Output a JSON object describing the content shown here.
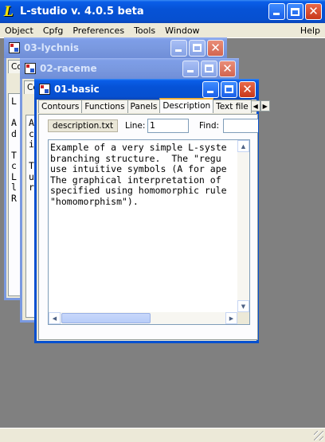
{
  "app": {
    "title": "L-studio v. 4.0.5 beta",
    "menu": [
      "Object",
      "Cpfg",
      "Preferences",
      "Tools",
      "Window"
    ],
    "help": "Help"
  },
  "windows": {
    "back": {
      "title": "03-lychnis",
      "tab_fragment": "Co",
      "letters": "L\n\nA\nd\n\nT\nc\nL\nl\nR"
    },
    "middle": {
      "title": "02-raceme",
      "tab_fragment": "Co",
      "letters": "A\nc\ni\n\nT\nu\nr"
    },
    "front": {
      "title": "01-basic",
      "tabs": [
        "Contours",
        "Functions",
        "Panels",
        "Description",
        "Text file"
      ],
      "active_tab": "Description",
      "file_name": "description.txt",
      "line_label": "Line:",
      "line_value": "1",
      "find_label": "Find:",
      "find_value": "",
      "text": "Example of a very simple L-syste\nbranching structure.  The \"regu\nuse intuitive symbols (A for ape\nThe graphical interpretation of \nspecified using homomorphic rule\n\"homomorphism\")."
    }
  },
  "colors": {
    "active_title": "#0650d0",
    "inactive_title": "#7a99e0",
    "mdi_background": "#808080",
    "face": "#ece9d8"
  }
}
